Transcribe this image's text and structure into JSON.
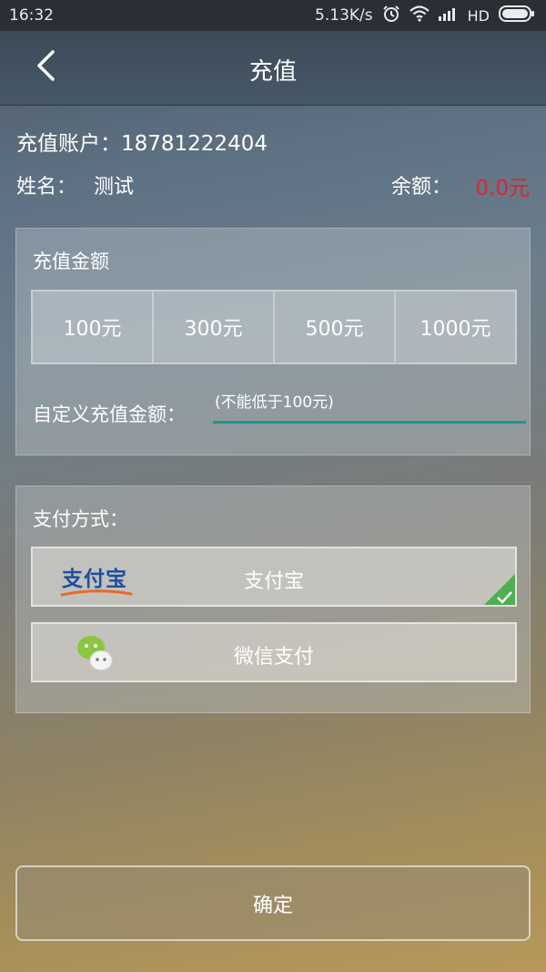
{
  "status_bar": {
    "time": "16:32",
    "net_speed": "5.13K/s",
    "network_type": "HD",
    "icons": [
      "alarm-icon",
      "wifi-icon",
      "signal-icon",
      "battery-icon"
    ]
  },
  "header": {
    "title": "充值",
    "back_icon": "back-arrow-icon"
  },
  "account": {
    "label": "充值账户：",
    "number": "18781222404",
    "name_label": "姓名：",
    "name_value": "测试",
    "balance_label": "余额：",
    "balance_value": "0.0元",
    "balance_color": "#e6202b"
  },
  "amount_section": {
    "label": "充值金额",
    "options": [
      "100元",
      "300元",
      "500元",
      "1000元"
    ],
    "custom_label": "自定义充值金额：",
    "custom_placeholder": "(不能低于100元)",
    "custom_value": "",
    "input_underline_color": "#1a9a8c"
  },
  "payment_section": {
    "label": "支付方式：",
    "options": [
      {
        "name": "支付宝",
        "logo_text": "支付宝",
        "icon": "alipay-icon",
        "selected": true
      },
      {
        "name": "微信支付",
        "icon": "wechat-icon",
        "selected": false
      }
    ],
    "check_color": "#4caf50"
  },
  "confirm": {
    "label": "确定"
  }
}
